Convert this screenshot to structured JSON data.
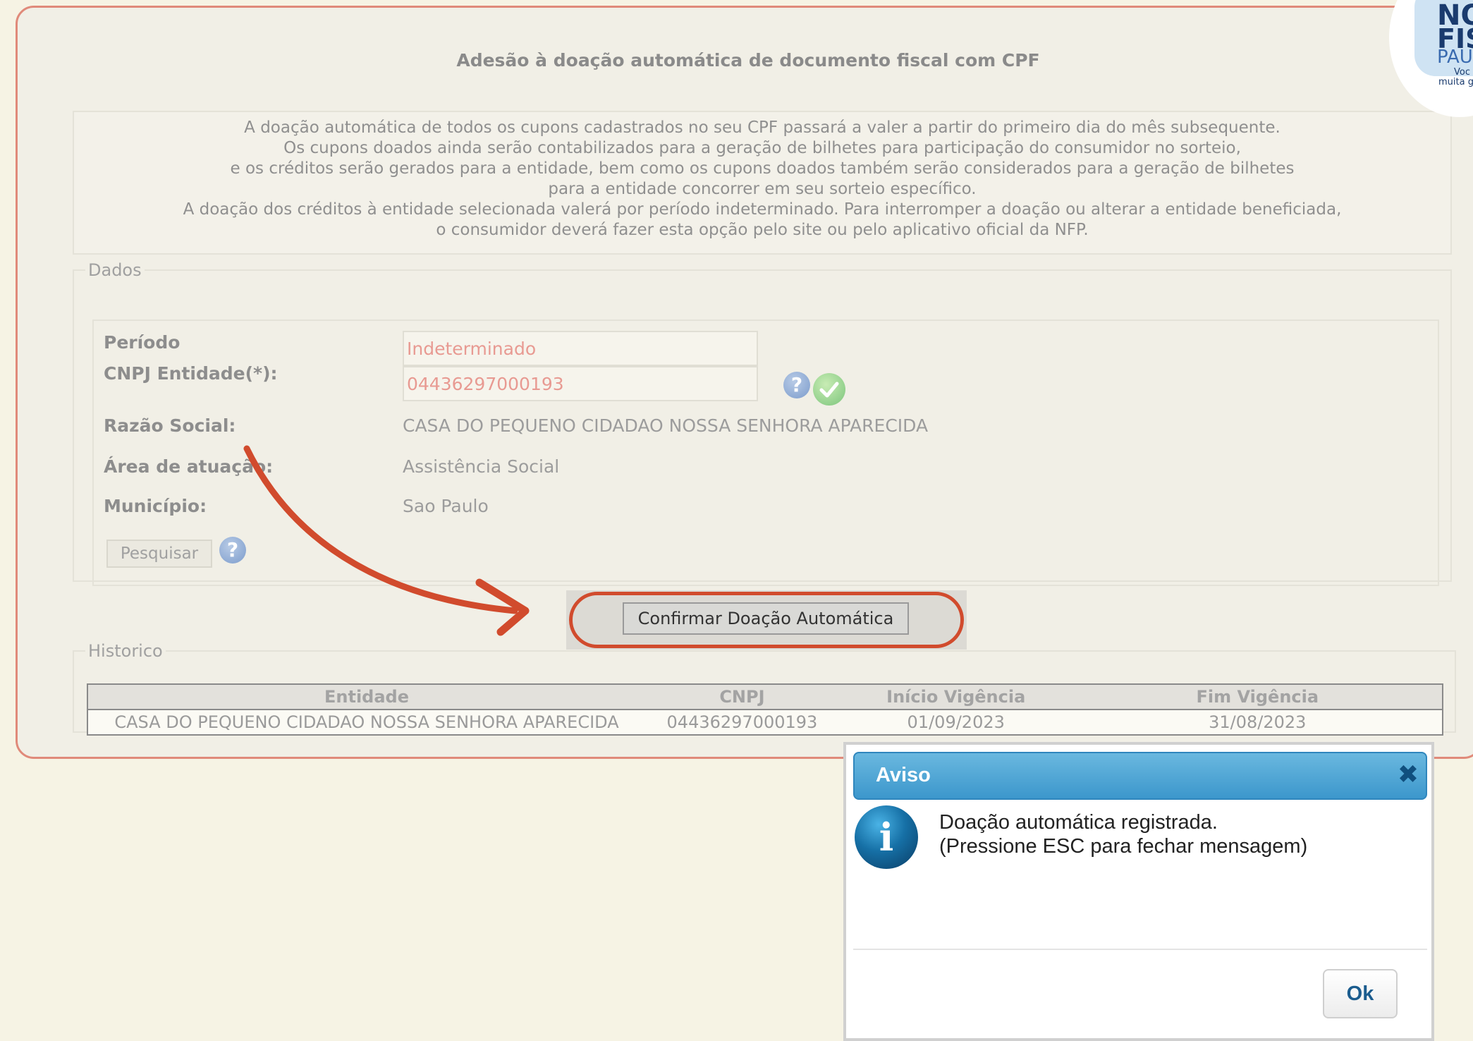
{
  "page": {
    "title": "Adesão à doação automática de documento fiscal com CPF",
    "notice_lines": [
      "A doação automática de todos os cupons cadastrados no seu CPF passará a valer a partir do primeiro dia do mês subsequente.",
      "Os cupons doados ainda serão contabilizados para a geração de bilhetes para participação do consumidor no sorteio,",
      "e os créditos serão gerados para a entidade, bem como os cupons doados também serão considerados para a geração de bilhetes",
      "para a entidade concorrer em seu sorteio específico.",
      "A doação dos créditos à entidade selecionada valerá por período indeterminado. Para interromper a doação ou alterar a entidade beneficiada,",
      "o consumidor deverá fazer esta opção pelo site ou pelo aplicativo oficial da NFP."
    ]
  },
  "logo": {
    "lines": [
      "NO",
      "FIS",
      "PAU",
      "Voc",
      "muita ge"
    ]
  },
  "dados": {
    "legend": "Dados",
    "periodo_label": "Período",
    "periodo_value": "Indeterminado",
    "cnpj_label": "CNPJ Entidade(*):",
    "cnpj_value": "04436297000193",
    "razao_label": "Razão Social:",
    "razao_value": "CASA DO PEQUENO CIDADAO NOSSA SENHORA APARECIDA",
    "area_label": "Área de atuação:",
    "area_value": "Assistência Social",
    "municipio_label": "Município:",
    "municipio_value": "Sao Paulo",
    "search_button": "Pesquisar",
    "help_glyph": "?"
  },
  "confirm_button": "Confirmar Doação Automática",
  "historico": {
    "legend": "Historico",
    "columns": [
      "Entidade",
      "CNPJ",
      "Início Vigência",
      "Fim Vigência"
    ],
    "rows": [
      [
        "CASA DO PEQUENO CIDADAO NOSSA SENHORA APARECIDA",
        "04436297000193",
        "01/09/2023",
        "31/08/2023"
      ]
    ]
  },
  "dialog": {
    "title": "Aviso",
    "close_glyph": "✖",
    "info_glyph": "i",
    "message_line1": "Doação automática registrada.",
    "message_line2": "(Pressione ESC para fechar mensagem)",
    "ok_button": "Ok"
  },
  "colors": {
    "panel_border": "#e08a7a",
    "annotation_arrow": "#d14b2d",
    "dialog_header": "#3c97cc"
  },
  "icons": [
    "help-icon",
    "valid-check-icon",
    "info-icon",
    "close-icon",
    "annotation-arrow"
  ]
}
